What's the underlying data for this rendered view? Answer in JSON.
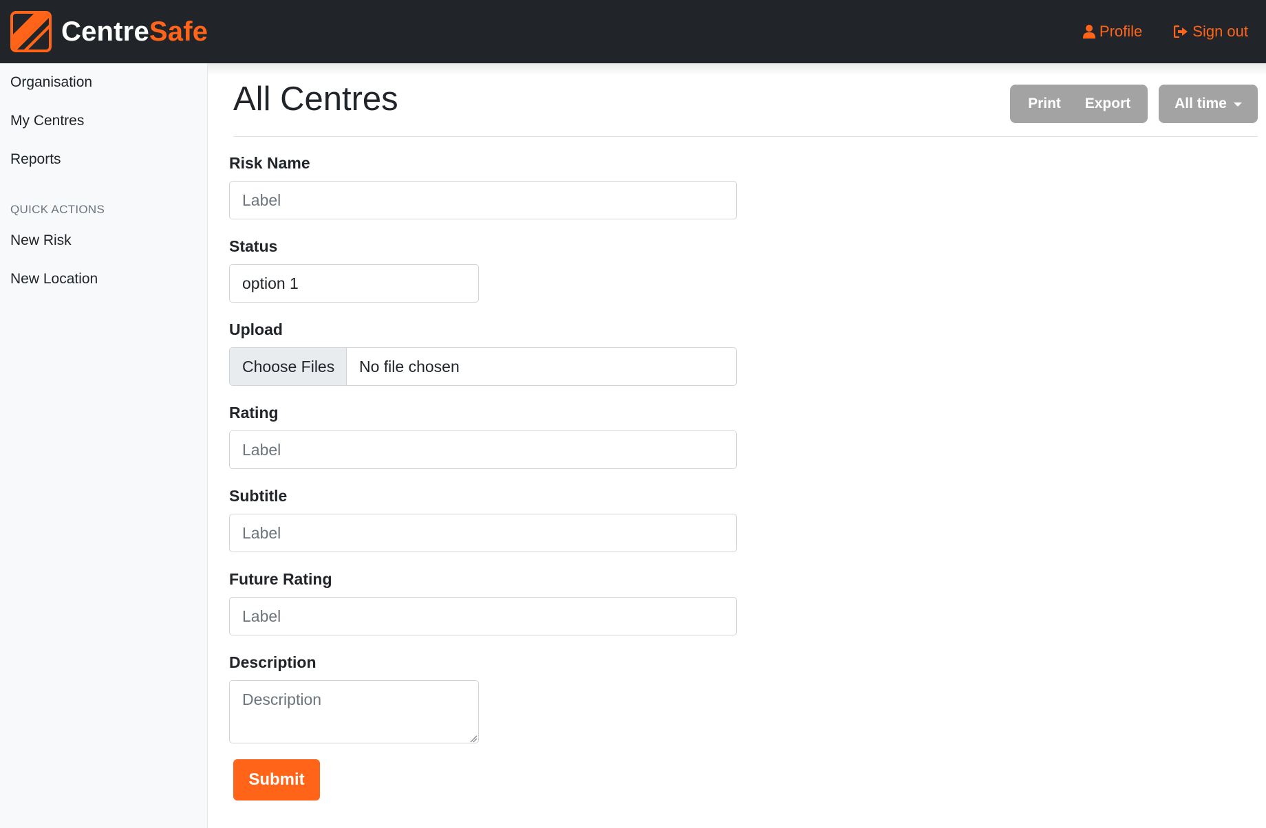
{
  "brand": {
    "name_part1": "Centre",
    "name_part2": "Safe",
    "logo_icon": "slash-logo-icon",
    "accent_color": "#ff6419",
    "navbar_color": "#212529"
  },
  "navbar": {
    "links": [
      {
        "label": "Profile",
        "icon": "user-icon"
      },
      {
        "label": "Sign out",
        "icon": "sign-out-icon"
      }
    ]
  },
  "sidebar": {
    "items": [
      {
        "label": "Organisation"
      },
      {
        "label": "My Centres"
      },
      {
        "label": "Reports"
      }
    ],
    "quick_actions_heading": "QUICK ACTIONS",
    "quick_actions": [
      {
        "label": "New Risk"
      },
      {
        "label": "New Location"
      }
    ]
  },
  "main": {
    "title": "All Centres",
    "toolbar": {
      "print_label": "Print",
      "export_label": "Export",
      "range_label": "All time"
    }
  },
  "form": {
    "risk_name": {
      "label": "Risk Name",
      "placeholder": "Label",
      "value": ""
    },
    "status": {
      "label": "Status",
      "value": "option 1"
    },
    "upload": {
      "label": "Upload",
      "button_label": "Choose Files",
      "status_text": "No file chosen"
    },
    "rating": {
      "label": "Rating",
      "placeholder": "Label",
      "value": ""
    },
    "subtitle": {
      "label": "Subtitle",
      "placeholder": "Label",
      "value": ""
    },
    "future_rating": {
      "label": "Future Rating",
      "placeholder": "Label",
      "value": ""
    },
    "description": {
      "label": "Description",
      "placeholder": "Description",
      "value": ""
    },
    "submit_label": "Submit"
  }
}
